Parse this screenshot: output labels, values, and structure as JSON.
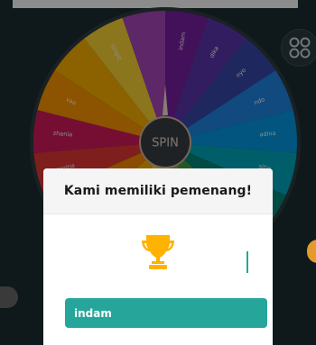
{
  "wheel": {
    "spin_label": "SPIN",
    "segments": [
      {
        "label": "indam",
        "color": "#7b1fa2"
      },
      {
        "label": "dika",
        "color": "#5e35b1"
      },
      {
        "label": "nyo",
        "color": "#3949ab"
      },
      {
        "label": "ndo",
        "color": "#1e88e5"
      },
      {
        "label": "adina",
        "color": "#039be5"
      },
      {
        "label": "sitiq",
        "color": "#00acc1"
      },
      {
        "label": "",
        "color": "#00897b"
      },
      {
        "label": "",
        "color": "#43a047"
      },
      {
        "label": "",
        "color": "#7cb342"
      },
      {
        "label": "",
        "color": "#c0ca33"
      },
      {
        "label": "",
        "color": "#fdd835"
      },
      {
        "label": "",
        "color": "#ffb300"
      },
      {
        "label": "",
        "color": "#fb8c00"
      },
      {
        "label": "regina",
        "color": "#e53935"
      },
      {
        "label": "zhania",
        "color": "#d81b60"
      },
      {
        "label": "vaa",
        "color": "#ff9800"
      },
      {
        "label": "",
        "color": "#ffb300"
      },
      {
        "label": "singiq",
        "color": "#fdd835"
      },
      {
        "label": "",
        "color": "#ab47bc"
      }
    ]
  },
  "modal": {
    "title": "Kami memiliki pemenang!",
    "winner": "indam"
  },
  "icons": {
    "menu": "grid-icon",
    "trophy": "trophy-icon"
  }
}
